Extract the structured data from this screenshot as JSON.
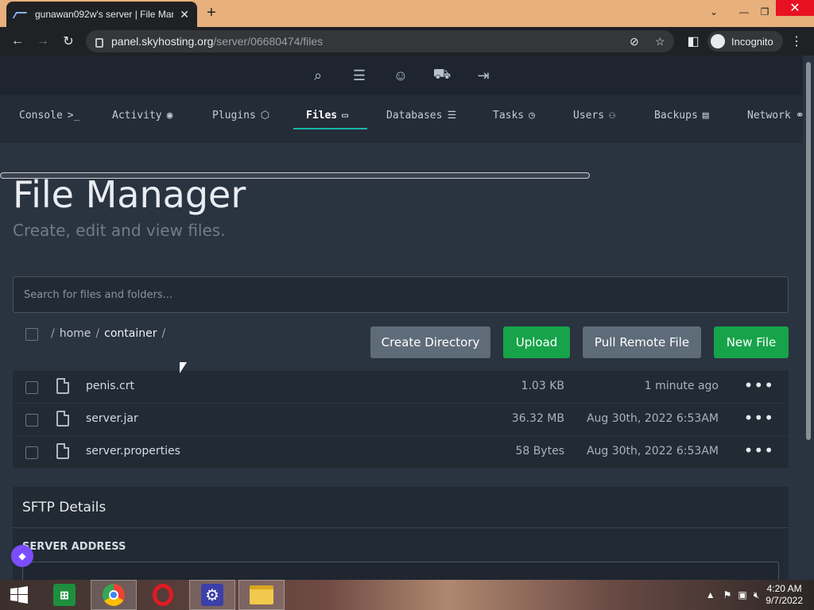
{
  "browser": {
    "tab_title": "gunawan092w's server | File Man",
    "url_host": "panel.skyhosting.org",
    "url_path": "/server/06680474/files",
    "incognito_label": "Incognito"
  },
  "topnav": {
    "icons": [
      "search-icon",
      "servers-icon",
      "account-icon",
      "cart-icon",
      "logout-icon"
    ]
  },
  "subnav": {
    "items": [
      {
        "label": "Console",
        "icon": ">_"
      },
      {
        "label": "Activity",
        "icon": "◉"
      },
      {
        "label": "Plugins",
        "icon": "⬡"
      },
      {
        "label": "Files",
        "icon": "▭"
      },
      {
        "label": "Databases",
        "icon": "☰"
      },
      {
        "label": "Tasks",
        "icon": "◷"
      },
      {
        "label": "Users",
        "icon": "⚇"
      },
      {
        "label": "Backups",
        "icon": "▤"
      },
      {
        "label": "Network",
        "icon": "⚭"
      }
    ],
    "active": "Files"
  },
  "page": {
    "title": "File Manager",
    "subtitle": "Create, edit and view files."
  },
  "search": {
    "placeholder": "Search for files and folders..."
  },
  "breadcrumb": {
    "sep": "/",
    "home": "home",
    "current": "container"
  },
  "actions": {
    "create_directory": "Create Directory",
    "upload": "Upload",
    "pull_remote": "Pull Remote File",
    "new_file": "New File"
  },
  "files": [
    {
      "name": "penis.crt",
      "size": "1.03 KB",
      "modified": "1 minute ago"
    },
    {
      "name": "server.jar",
      "size": "36.32 MB",
      "modified": "Aug 30th, 2022 6:53AM"
    },
    {
      "name": "server.properties",
      "size": "58 Bytes",
      "modified": "Aug 30th, 2022 6:53AM"
    }
  ],
  "file_menu_glyph": "•••",
  "sftp": {
    "title": "SFTP Details",
    "server_address_label": "SERVER ADDRESS"
  },
  "taskbar": {
    "time": "4:20 AM",
    "date": "9/7/2022"
  },
  "colors": {
    "accent": "#15b8a6",
    "green": "#17a34a",
    "gray_button": "#5e6b79"
  }
}
